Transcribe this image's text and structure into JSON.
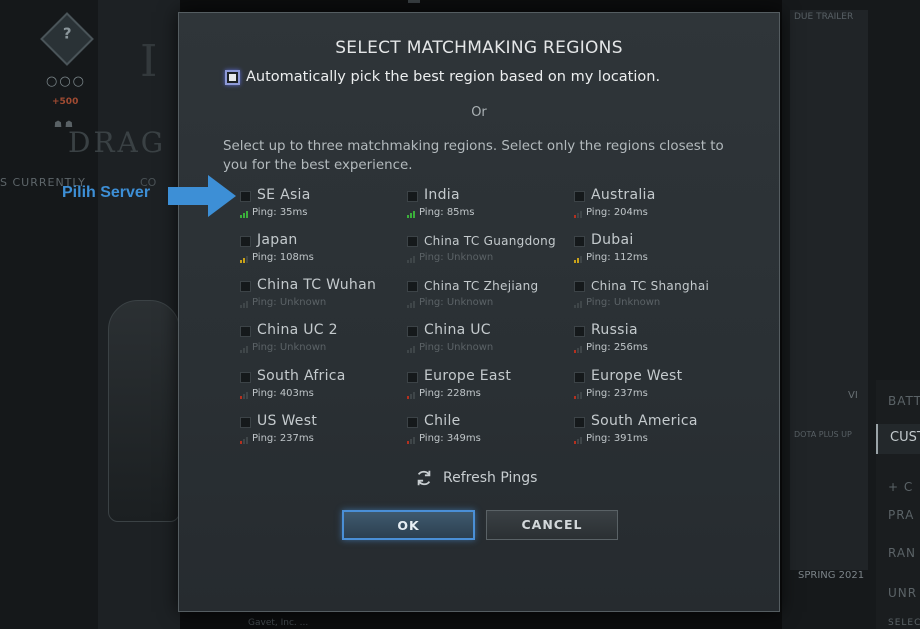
{
  "background": {
    "rank_icon_glyph": "?",
    "dots": "○○○",
    "plus_text": "+500",
    "currently_text": "S CURRENTLY",
    "big_letter": "I",
    "drag_text": "DRAG",
    "co_text": "CO",
    "trailer_text": "DUE TRAILER",
    "vi_text": "VI",
    "dota_plus_text": "DOTA PLUS UP",
    "spring_text": "SPRING 2021",
    "right_strip": [
      "BATT",
      "CUST",
      "+ C",
      "PRA",
      "RAN",
      "UNR",
      "SELEC"
    ],
    "bottom_text": "Gavet, Inc. ..."
  },
  "dialog": {
    "title": "SELECT MATCHMAKING REGIONS",
    "auto_pick_label": "Automatically pick the best region based on my location.",
    "auto_pick_checked": true,
    "or_text": "Or",
    "description": "Select up to three matchmaking regions. Select only the regions closest to you for the best experience.",
    "regions": [
      {
        "name": "SE Asia",
        "ping": "Ping: 35ms",
        "signal": "good"
      },
      {
        "name": "India",
        "ping": "Ping: 85ms",
        "signal": "good"
      },
      {
        "name": "Australia",
        "ping": "Ping: 204ms",
        "signal": "bad"
      },
      {
        "name": "Japan",
        "ping": "Ping: 108ms",
        "signal": "mid"
      },
      {
        "name": "China TC Guangdong",
        "ping": "Ping: Unknown",
        "signal": "none"
      },
      {
        "name": "Dubai",
        "ping": "Ping: 112ms",
        "signal": "mid"
      },
      {
        "name": "China TC Wuhan",
        "ping": "Ping: Unknown",
        "signal": "none"
      },
      {
        "name": "China TC Zhejiang",
        "ping": "Ping: Unknown",
        "signal": "none"
      },
      {
        "name": "China TC Shanghai",
        "ping": "Ping: Unknown",
        "signal": "none"
      },
      {
        "name": "China UC 2",
        "ping": "Ping: Unknown",
        "signal": "none"
      },
      {
        "name": "China UC",
        "ping": "Ping: Unknown",
        "signal": "none"
      },
      {
        "name": "Russia",
        "ping": "Ping: 256ms",
        "signal": "bad"
      },
      {
        "name": "South Africa",
        "ping": "Ping: 403ms",
        "signal": "bad"
      },
      {
        "name": "Europe East",
        "ping": "Ping: 228ms",
        "signal": "bad"
      },
      {
        "name": "Europe West",
        "ping": "Ping: 237ms",
        "signal": "bad"
      },
      {
        "name": "US West",
        "ping": "Ping: 237ms",
        "signal": "bad"
      },
      {
        "name": "Chile",
        "ping": "Ping: 349ms",
        "signal": "bad"
      },
      {
        "name": "South America",
        "ping": "Ping: 391ms",
        "signal": "bad"
      }
    ],
    "refresh_label": "Refresh Pings",
    "ok_label": "OK",
    "cancel_label": "CANCEL"
  },
  "annotation": {
    "label": "Pilih Server",
    "color": "#3d8fd6"
  },
  "colors": {
    "signal_good": "#3bb03b",
    "signal_mid": "#c9a21a",
    "signal_bad": "#b5301f",
    "ok_border": "#4a8fd6"
  }
}
